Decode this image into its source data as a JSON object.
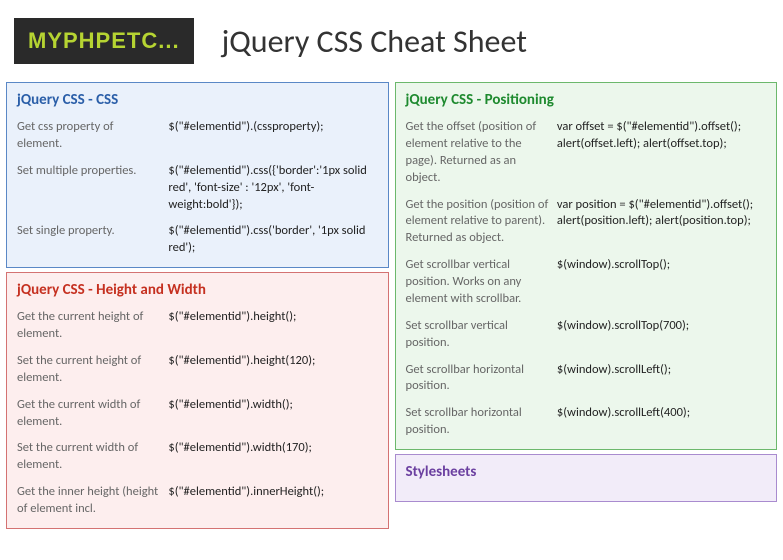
{
  "header": {
    "logo": "MYPHPETC...",
    "title": "jQuery CSS Cheat Sheet"
  },
  "panels": {
    "css": {
      "title": "jQuery CSS - CSS",
      "rows": [
        {
          "desc": "Get css property of element.",
          "code": "$(\"#elementid\").(cssproperty);"
        },
        {
          "desc": "Set multiple properties.",
          "code": "$(\"#elementid\").css({'border':'1px solid red',  'font-size' : '12px', 'font-weight:bold'});"
        },
        {
          "desc": "Set single property.",
          "code": "$(\"#elementid\").css('border', '1px solid red');"
        }
      ]
    },
    "hw": {
      "title": "jQuery CSS - Height and Width",
      "rows": [
        {
          "desc": "Get the current height of element.",
          "code": "$(\"#elementid\").height();"
        },
        {
          "desc": "Set the current height of element.",
          "code": "$(\"#elementid\").height(120);"
        },
        {
          "desc": "Get the current width of element.",
          "code": "$(\"#elementid\").width();"
        },
        {
          "desc": "Set the current width of element.",
          "code": "$(\"#elementid\").width(170);"
        },
        {
          "desc": "Get the inner height (height of element incl.",
          "code": "$(\"#elementid\").innerHeight();"
        }
      ]
    },
    "pos": {
      "title": "jQuery CSS - Positioning",
      "rows": [
        {
          "desc": "Get the offset (position of element relative to the page). Returned as an object.",
          "code": "var offset = $(\"#elementid\").offset(); alert(offset.left); alert(offset.top);"
        },
        {
          "desc": "Get the position (position of element relative to parent). Returned as object.",
          "code": "var position = $(\"#elementid\").offset(); alert(position.left); alert(position.top);"
        },
        {
          "desc": "Get scrollbar vertical position. Works on any element with scrollbar.",
          "code": "$(window).scrollTop();"
        },
        {
          "desc": "Set scrollbar vertical position.",
          "code": "$(window).scrollTop(700);"
        },
        {
          "desc": "Get scrollbar horizontal position.",
          "code": "$(window).scrollLeft();"
        },
        {
          "desc": "Set scrollbar horizontal position.",
          "code": "$(window).scrollLeft(400);"
        }
      ]
    },
    "styles": {
      "title": "Stylesheets"
    }
  }
}
